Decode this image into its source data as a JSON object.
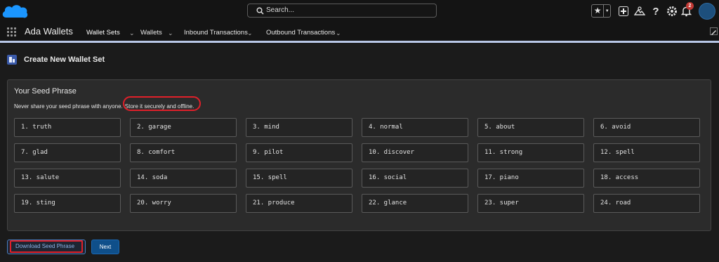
{
  "header": {
    "search_placeholder": "Search...",
    "notification_count": "2"
  },
  "nav": {
    "app_name": "Ada Wallets",
    "tabs": [
      {
        "label": "Wallet Sets"
      },
      {
        "label": "Wallets"
      },
      {
        "label": "Inbound Transactions"
      },
      {
        "label": "Outbound Transactions"
      }
    ]
  },
  "page": {
    "title": "Create New Wallet Set"
  },
  "seed": {
    "title": "Your Seed Phrase",
    "warning_part1": "Never share your seed phrase with anyone.",
    "warning_part2": "Store it securely and offline.",
    "words": [
      "1. truth",
      "2. garage",
      "3. mind",
      "4. normal",
      "5. about",
      "6. avoid",
      "7. glad",
      "8. comfort",
      "9. pilot",
      "10. discover",
      "11. strong",
      "12. spell",
      "13. salute",
      "14. soda",
      "15. spell",
      "16. social",
      "17. piano",
      "18. access",
      "19. sting",
      "20. worry",
      "21. produce",
      "22. glance",
      "23. super",
      "24. road"
    ]
  },
  "actions": {
    "download_label": "Download Seed Phrase",
    "next_label": "Next"
  },
  "colors": {
    "brand_blue": "#1b96ff",
    "accent_button": "#0f4f8a",
    "annotation_red": "#e0202a"
  }
}
